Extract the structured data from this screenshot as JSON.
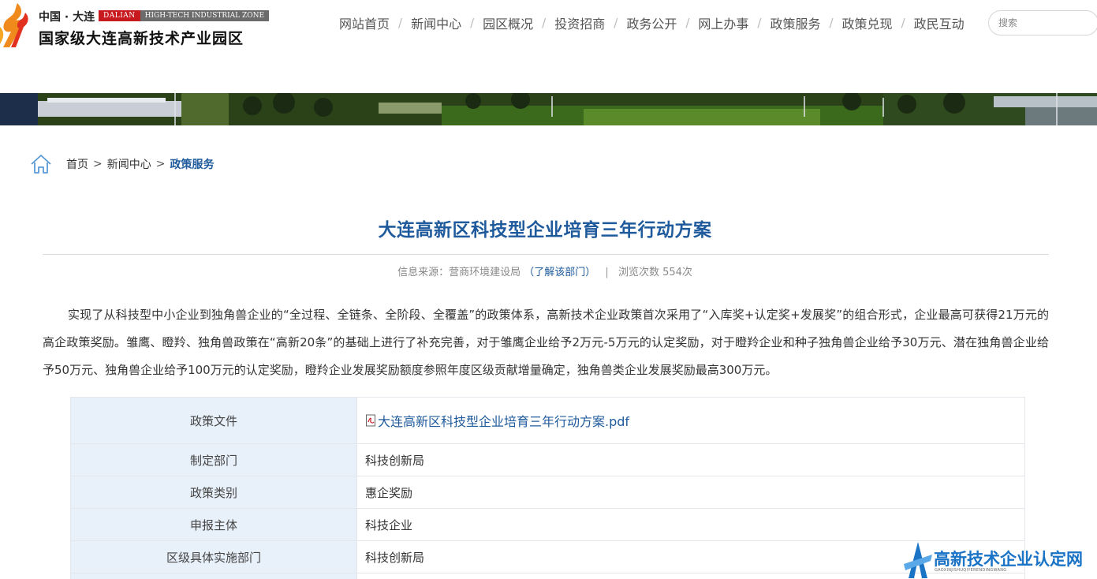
{
  "header": {
    "logo_top": "中国 · 大连",
    "badge_dalian": "DALIAN",
    "badge_zone": "HIGH-TECH INDUSTRIAL ZONE",
    "logo_main": "国家级大连高新技术产业园区",
    "nav": [
      "网站首页",
      "新闻中心",
      "园区概况",
      "投资招商",
      "政务公开",
      "网上办事",
      "政策服务",
      "政策兑现",
      "政民互动"
    ],
    "search_placeholder": "搜索"
  },
  "breadcrumb": {
    "home": "首页",
    "sep": ">",
    "level1": "新闻中心",
    "current": "政策服务"
  },
  "article": {
    "title": "大连高新区科技型企业培育三年行动方案",
    "source_label": "信息来源：",
    "source": "营商环境建设局",
    "dept_link": "（了解该部门）",
    "divider": "|",
    "views_label": "浏览次数",
    "views": "554次",
    "body": "实现了从科技型中小企业到独角兽企业的“全过程、全链条、全阶段、全覆盖”的政策体系，高新技术企业政策首次采用了“入库奖+认定奖+发展奖”的组合形式，企业最高可获得21万元的高企政策奖励。雏鹰、瞪羚、独角兽政策在“高新20条”的基础上进行了补充完善，对于雏鹰企业给予2万元-5万元的认定奖励，对于瞪羚企业和种子独角兽企业给予30万元、潜在独角兽企业给予50万元、独角兽企业给予100万元的认定奖励，瞪羚企业发展奖励额度参照年度区级贡献增量确定，独角兽类企业发展奖励最高300万元。"
  },
  "table": {
    "rows": [
      {
        "key": "政策文件",
        "value": "大连高新区科技型企业培育三年行动方案.pdf"
      },
      {
        "key": "制定部门",
        "value": "科技创新局"
      },
      {
        "key": "政策类别",
        "value": "惠企奖励"
      },
      {
        "key": "申报主体",
        "value": "科技企业"
      },
      {
        "key": "区级具体实施部门",
        "value": "科技创新局"
      },
      {
        "key": "",
        "value": ""
      }
    ]
  },
  "watermark": {
    "text": "高新技术企业认定网",
    "sub": "GAOXINJISHUQIYERENDINGWANG"
  },
  "colors": {
    "accent_blue": "#1e5a9c",
    "table_key_bg": "#e8f0fa",
    "logo_red": "#c8191f",
    "logo_orange": "#f08a1c"
  }
}
